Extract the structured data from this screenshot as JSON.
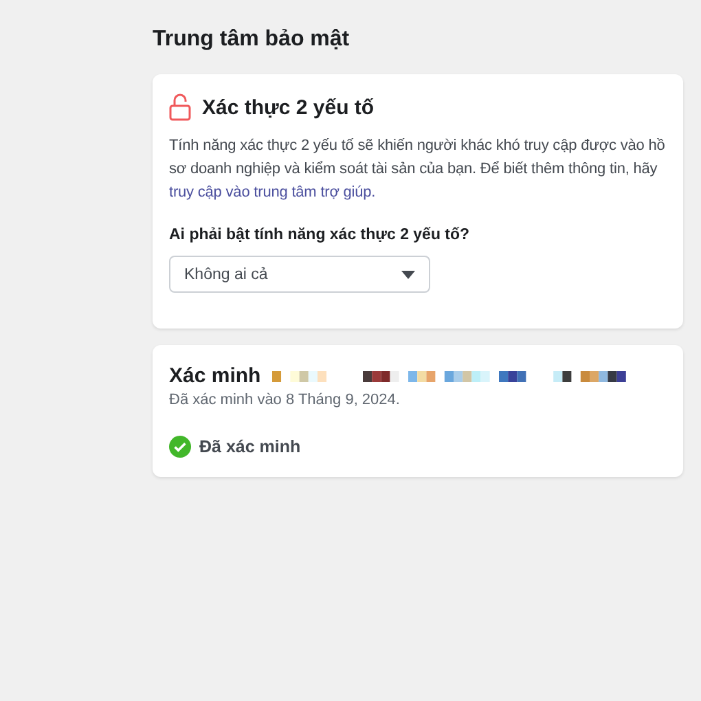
{
  "page_title": "Trung tâm bảo mật",
  "two_factor": {
    "title": "Xác thực 2 yếu tố",
    "enabled": false,
    "description": "Tính năng xác thực 2 yếu tố sẽ khiến người khác khó truy cập được vào hồ sơ doanh nghiệp và kiểm soát tài sản của bạn. Để biết thêm thông tin, hãy",
    "help_link": "truy cập vào trung tâm trợ giúp.",
    "question": "Ai phải bật tính năng xác thực 2 yếu tố?",
    "select_value": "Không ai cả"
  },
  "verification": {
    "title": "Xác minh",
    "date": "Đã xác minh vào 8 Tháng 9, 2024.",
    "verified": true,
    "status": "Đã xác minh"
  }
}
